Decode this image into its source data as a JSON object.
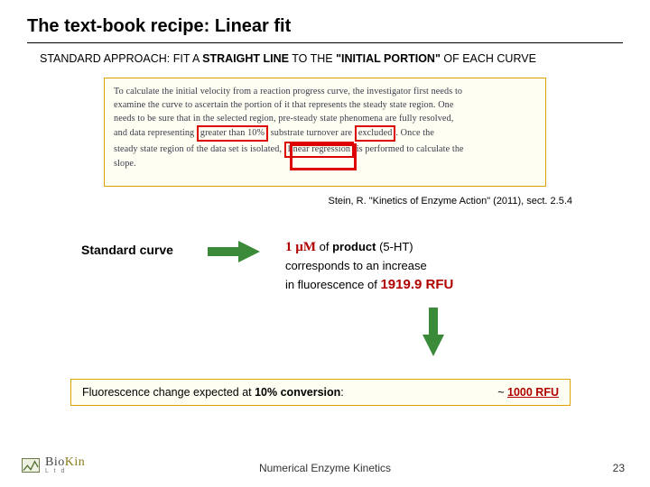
{
  "title": "The text-book recipe: Linear fit",
  "subhead": {
    "pre": "STANDARD APPROACH: FIT A ",
    "b1": "STRAIGHT LINE",
    "mid": " TO THE ",
    "b2": "\"INITIAL PORTION\"",
    "post": " OF EACH CURVE"
  },
  "quote": {
    "l1": "To calculate the initial velocity from a reaction progress curve, the investigator first needs to",
    "l2": "examine the curve to ascertain the portion of it that represents the steady state region. One",
    "l3": "needs to be sure that in the selected region, pre-steady state phenomena are fully resolved,",
    "l4a": "and data representing ",
    "l4b": "greater than 10%",
    "l4c": " substrate turnover are ",
    "l4d": "excluded",
    "l4e": ". Once the",
    "l5a": "steady state region of the data set is isolated, ",
    "l5b": "linear regression",
    "l5c": " is performed to calculate the",
    "l6": "slope."
  },
  "cite": "Stein, R. \"Kinetics of Enzyme Action\" (2011), sect. 2.5.4",
  "stdcurve": "Standard curve",
  "conv": {
    "one_mu": "1 µM",
    "of_product": " of ",
    "product_b": "product",
    "product_tail": " (5-HT)",
    "line2": "corresponds to an increase",
    "line3a": "in fluorescence of ",
    "rfu": "1919.9 RFU"
  },
  "expect": {
    "left_a": "Fluorescence change expected at ",
    "left_b": "10% conversion",
    "left_c": ":",
    "right_a": "~ ",
    "right_b": "1000 RFU"
  },
  "footer": {
    "center": "Numerical Enzyme Kinetics",
    "page": "23",
    "logo1": "Bio",
    "logo2": "Kin",
    "ltd": "L t d"
  }
}
